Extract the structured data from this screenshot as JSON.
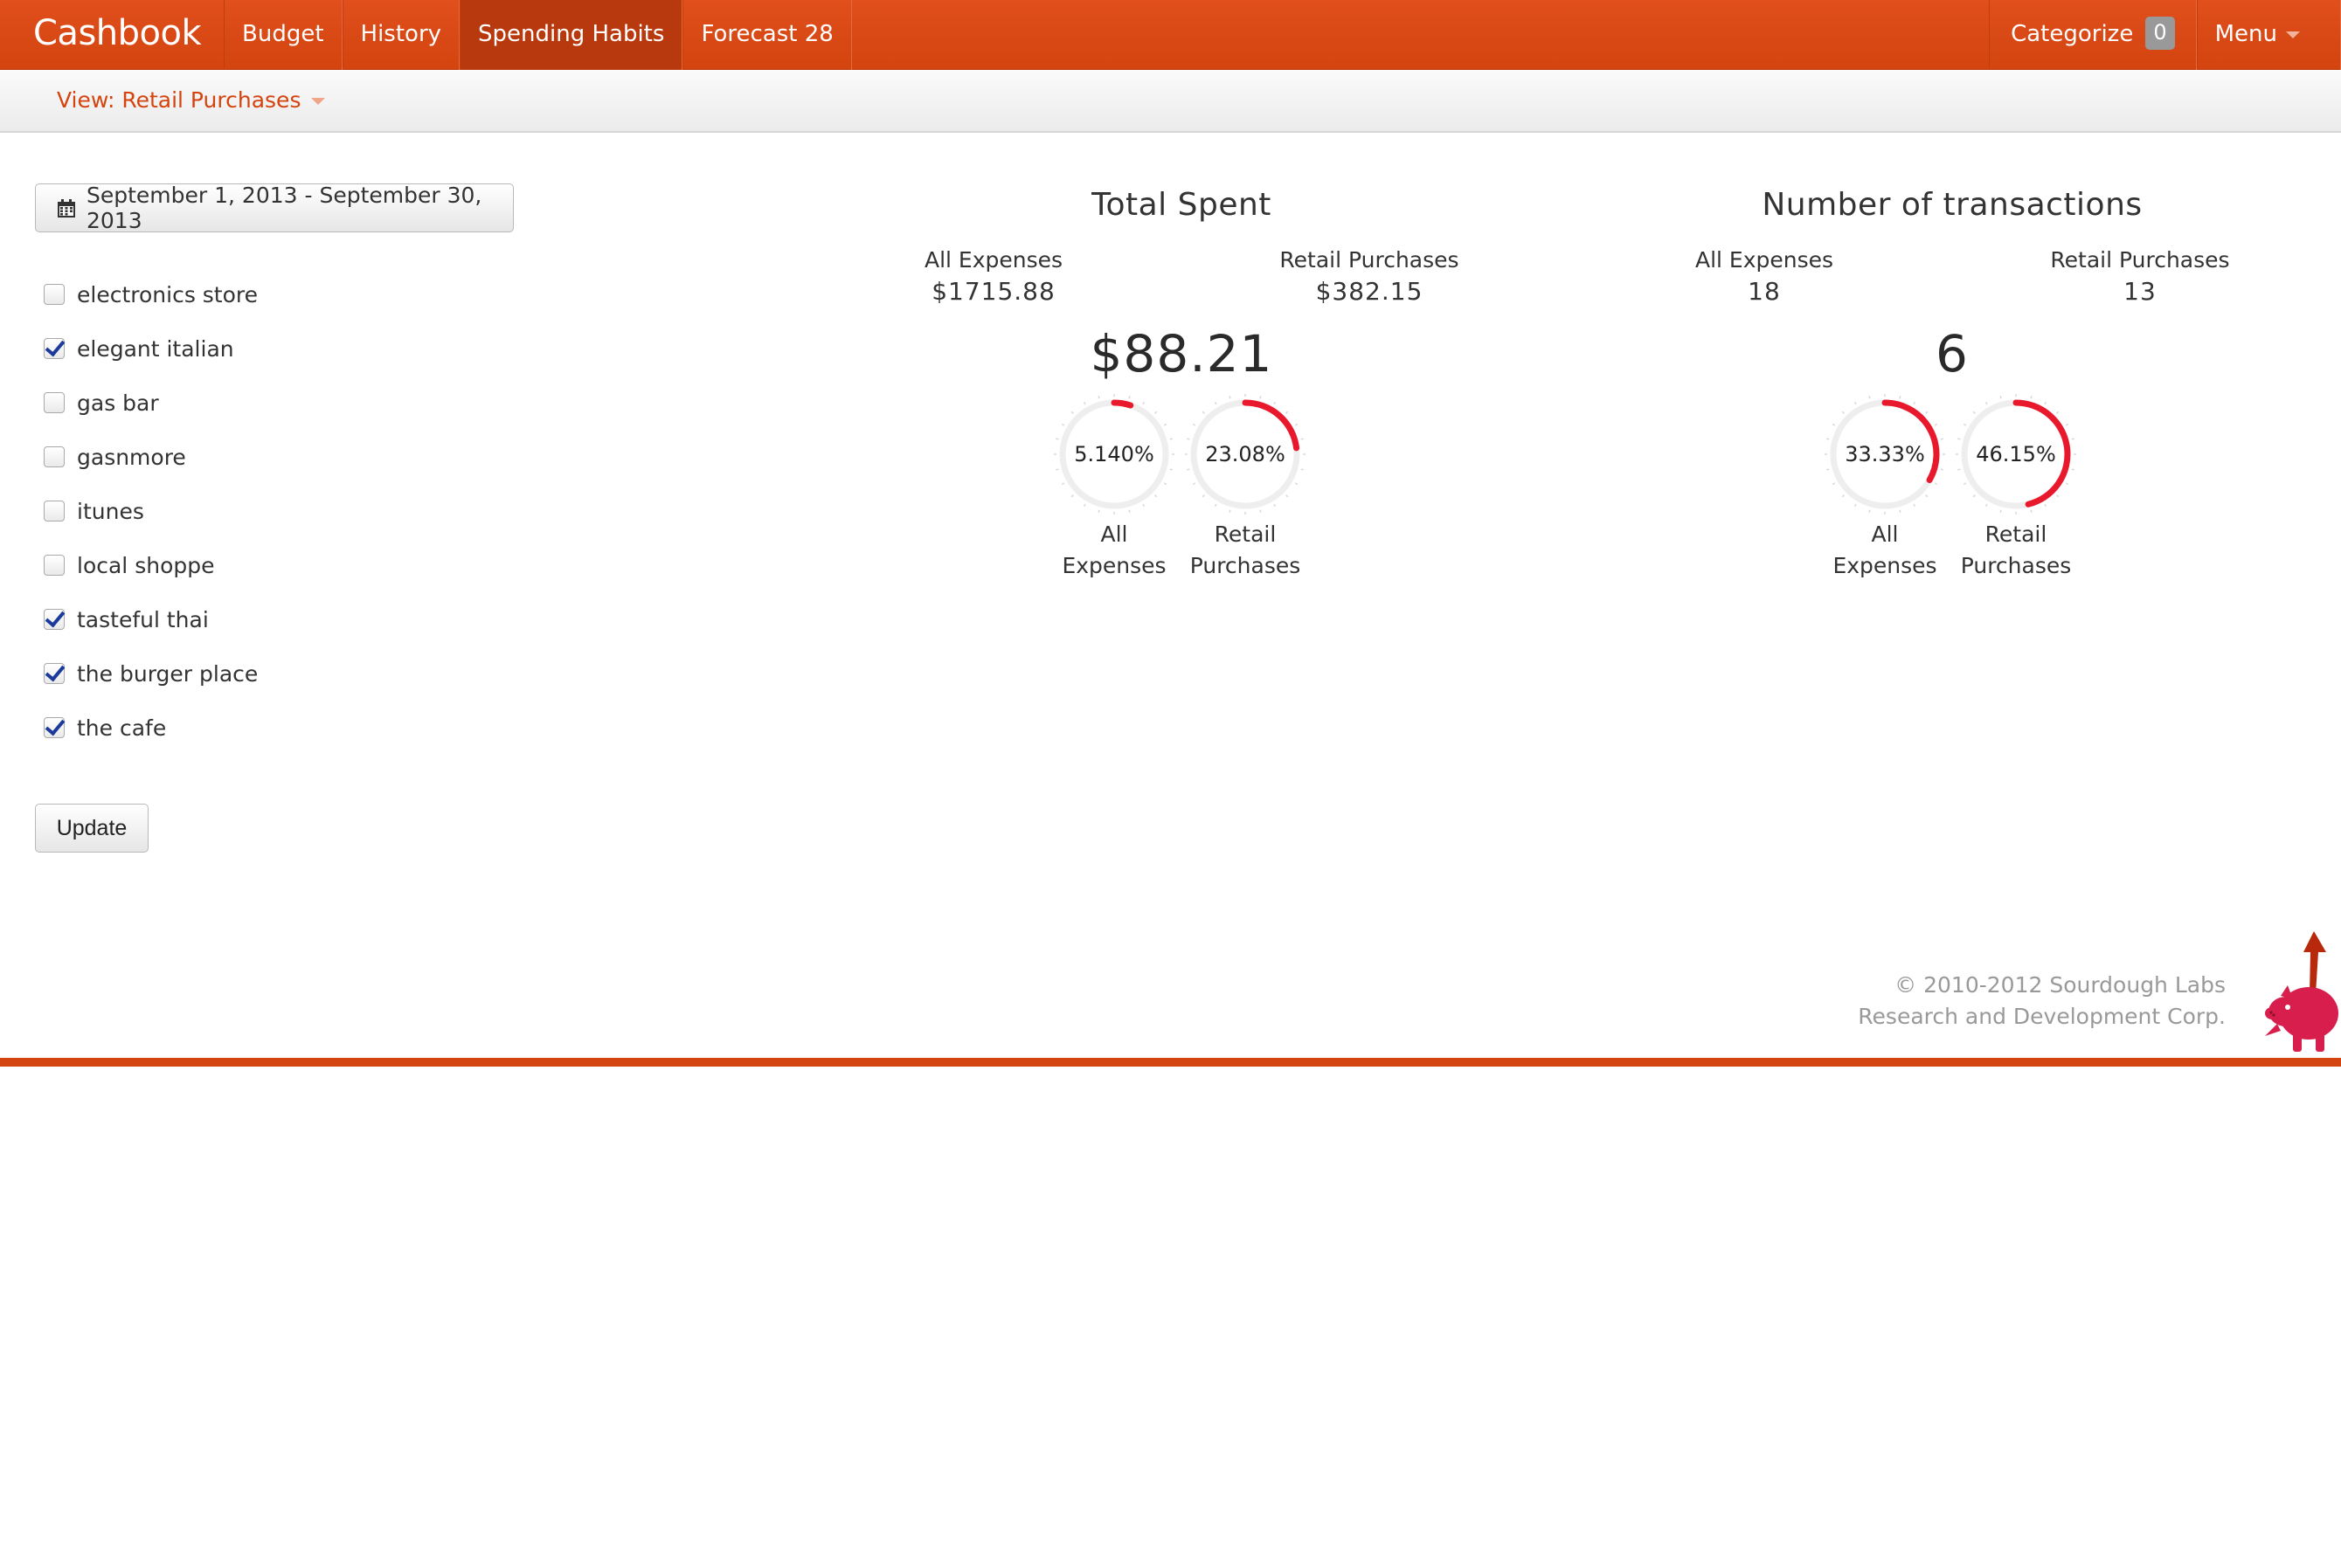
{
  "nav": {
    "brand": "Cashbook",
    "items": [
      {
        "label": "Budget"
      },
      {
        "label": "History"
      },
      {
        "label": "Spending Habits"
      },
      {
        "label": "Forecast 28"
      }
    ],
    "categorize_label": "Categorize",
    "categorize_count": "0",
    "menu_label": "Menu"
  },
  "subbar": {
    "view_label": "View: Retail Purchases"
  },
  "date_range": "September 1, 2013 - September 30, 2013",
  "filters": [
    {
      "label": "electronics store",
      "checked": false
    },
    {
      "label": "elegant italian",
      "checked": true
    },
    {
      "label": "gas bar",
      "checked": false
    },
    {
      "label": "gasnmore",
      "checked": false
    },
    {
      "label": "itunes",
      "checked": false
    },
    {
      "label": "local shoppe",
      "checked": false
    },
    {
      "label": "tasteful thai",
      "checked": true
    },
    {
      "label": "the burger place",
      "checked": true
    },
    {
      "label": "the cafe",
      "checked": true
    }
  ],
  "update_label": "Update",
  "total_spent": {
    "title": "Total Spent",
    "all_label": "All Expenses",
    "all_value": "$1715.88",
    "retail_label": "Retail Purchases",
    "retail_value": "$382.15",
    "selected_value": "$88.21",
    "gauges": [
      {
        "text": "5.140%",
        "fraction": 0.0514,
        "label_line1": "All",
        "label_line2": "Expenses"
      },
      {
        "text": "23.08%",
        "fraction": 0.2308,
        "label_line1": "Retail",
        "label_line2": "Purchases"
      }
    ]
  },
  "transactions": {
    "title": "Number of transactions",
    "all_label": "All Expenses",
    "all_value": "18",
    "retail_label": "Retail Purchases",
    "retail_value": "13",
    "selected_value": "6",
    "gauges": [
      {
        "text": "33.33%",
        "fraction": 0.3333,
        "label_line1": "All",
        "label_line2": "Expenses"
      },
      {
        "text": "46.15%",
        "fraction": 0.4615,
        "label_line1": "Retail",
        "label_line2": "Purchases"
      }
    ]
  },
  "footer": {
    "line1": "© 2010-2012 Sourdough Labs",
    "line2": "Research and Development Corp."
  },
  "colors": {
    "brand": "#d3440f",
    "gauge_fill": "#e8192c",
    "gauge_track": "#eeeeee",
    "mascot": "#d81e4c",
    "arrow": "#b8280b"
  },
  "icons": [
    "calendar-icon",
    "checkbox-icon",
    "pig-mascot-icon",
    "up-arrow-icon"
  ]
}
